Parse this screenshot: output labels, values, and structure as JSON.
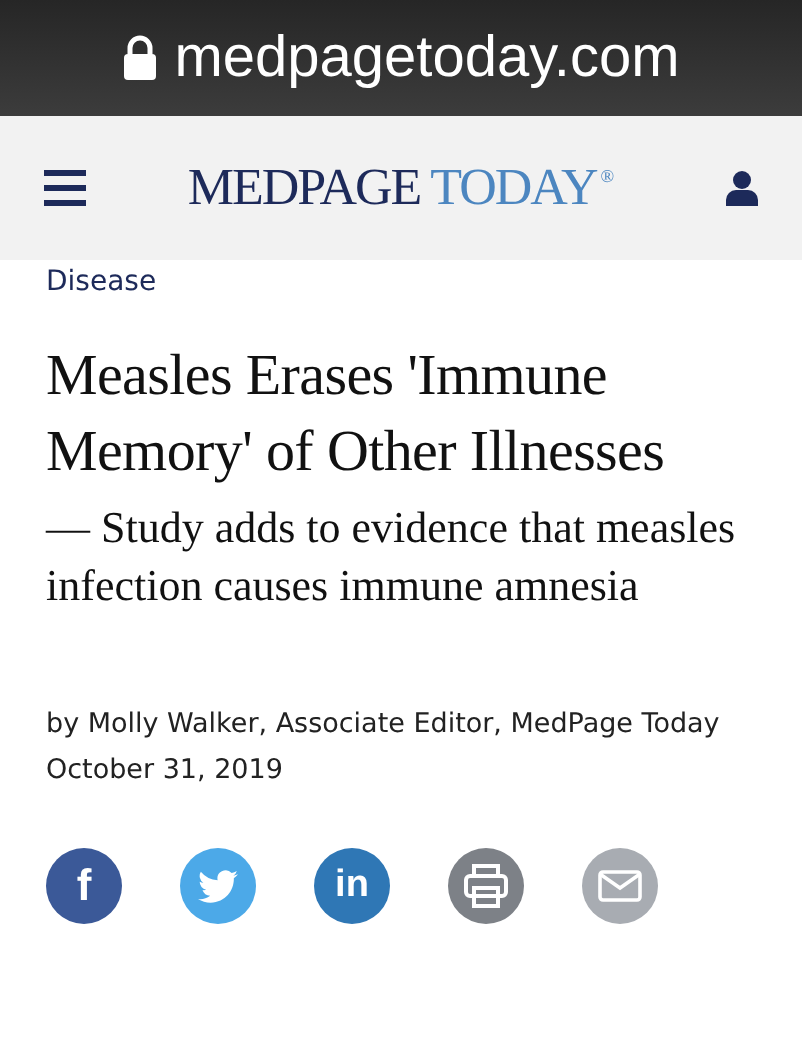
{
  "address_bar": {
    "url": "medpagetoday.com"
  },
  "header": {
    "logo": {
      "part_1": "MEDPAGE",
      "part_2": "TODAY",
      "mark": "®"
    }
  },
  "article": {
    "category": "Disease",
    "headline": "Measles Erases 'Immune Memory' of Other Illnesses",
    "subtitle": "— Study adds to evidence that measles infection causes immune amnesia",
    "byline": "by Molly Walker, Associate Editor, MedPage Today",
    "date": "October 31, 2019"
  },
  "share_buttons": [
    {
      "kind": "facebook",
      "label": "f",
      "color": "#3b5998"
    },
    {
      "kind": "twitter",
      "color": "#4ca9e8"
    },
    {
      "kind": "linkedin",
      "label": "in",
      "color": "#2f77b5"
    },
    {
      "kind": "print",
      "color": "#7d8187"
    },
    {
      "kind": "email",
      "color": "#a8acb2"
    }
  ]
}
